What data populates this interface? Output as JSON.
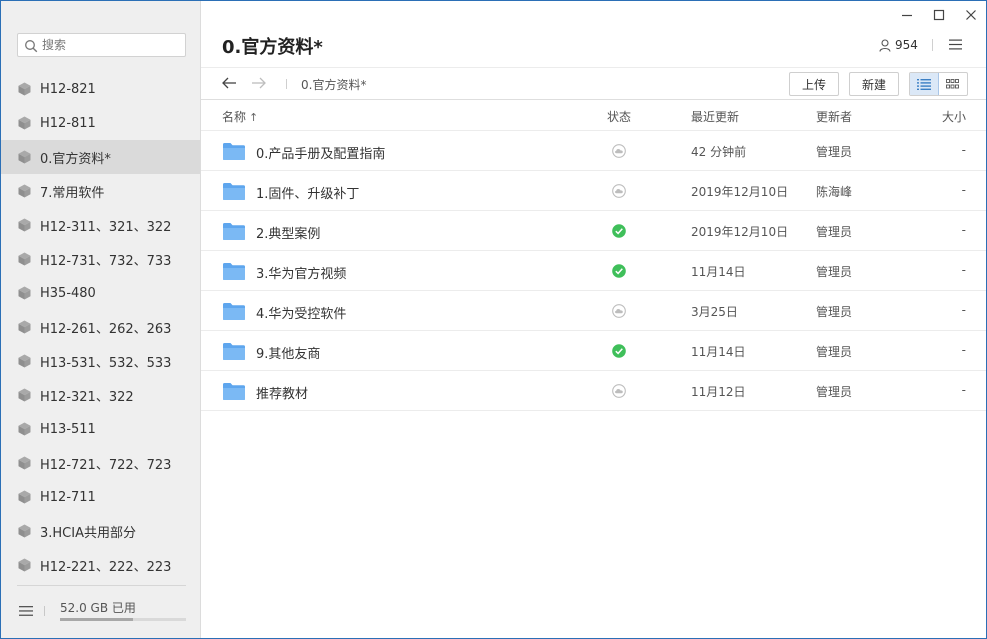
{
  "sidebar": {
    "search_placeholder": "搜索",
    "items": [
      {
        "label": "H12-821",
        "active": false
      },
      {
        "label": "H12-811",
        "active": false
      },
      {
        "label": "0.官方资料*",
        "active": true
      },
      {
        "label": "7.常用软件",
        "active": false
      },
      {
        "label": "H12-311、321、322",
        "active": false
      },
      {
        "label": "H12-731、732、733",
        "active": false
      },
      {
        "label": "H35-480",
        "active": false
      },
      {
        "label": "H12-261、262、263",
        "active": false
      },
      {
        "label": "H13-531、532、533",
        "active": false
      },
      {
        "label": "H12-321、322",
        "active": false
      },
      {
        "label": "H13-511",
        "active": false
      },
      {
        "label": "H12-721、722、723",
        "active": false
      },
      {
        "label": "H12-711",
        "active": false
      },
      {
        "label": "3.HCIA共用部分",
        "active": false
      },
      {
        "label": "H12-221、222、223",
        "active": false
      }
    ],
    "storage_label": "52.0 GB 已用",
    "storage_fraction": 0.58
  },
  "header": {
    "title": "0.官方资料*",
    "member_count": "954"
  },
  "toolbar": {
    "breadcrumb": "0.官方资料*",
    "upload_label": "上传",
    "new_label": "新建"
  },
  "table": {
    "columns": {
      "name": "名称",
      "sort_indicator": "↑",
      "status": "状态",
      "updated": "最近更新",
      "updater": "更新者",
      "size": "大小"
    },
    "rows": [
      {
        "name": "0.产品手册及配置指南",
        "status": "cloud",
        "updated": "42 分钟前",
        "updater": "管理员",
        "size": "-"
      },
      {
        "name": "1.固件、升级补丁",
        "status": "cloud",
        "updated": "2019年12月10日",
        "updater": "陈海峰",
        "size": "-"
      },
      {
        "name": "2.典型案例",
        "status": "synced",
        "updated": "2019年12月10日",
        "updater": "管理员",
        "size": "-"
      },
      {
        "name": "3.华为官方视频",
        "status": "synced",
        "updated": "11月14日",
        "updater": "管理员",
        "size": "-"
      },
      {
        "name": "4.华为受控软件",
        "status": "cloud",
        "updated": "3月25日",
        "updater": "管理员",
        "size": "-"
      },
      {
        "name": "9.其他友商",
        "status": "synced",
        "updated": "11月14日",
        "updater": "管理员",
        "size": "-"
      },
      {
        "name": "推荐教材",
        "status": "cloud",
        "updated": "11月12日",
        "updater": "管理员",
        "size": "-"
      }
    ]
  },
  "colors": {
    "accent": "#3b7fc4",
    "folder": "#6aaef0",
    "synced": "#3fbf5a",
    "cloud": "#bdbdbd"
  }
}
